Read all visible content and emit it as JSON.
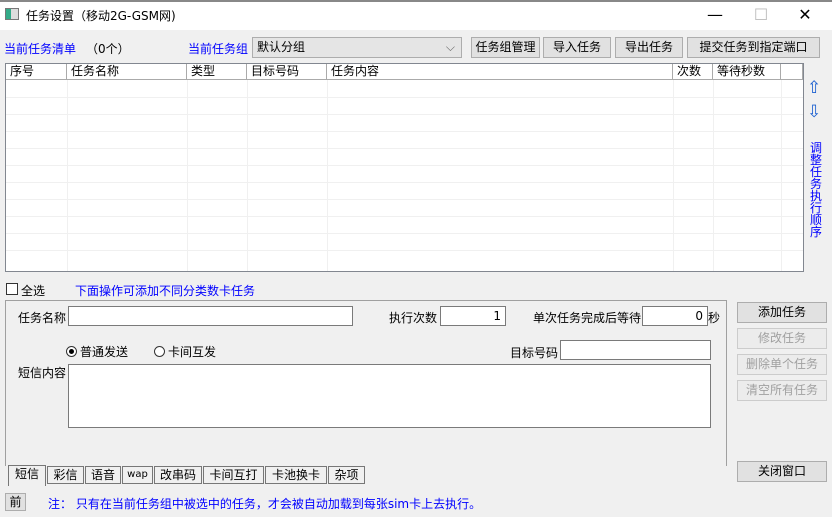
{
  "window": {
    "title": "任务设置（移动2G-GSM网)",
    "minimize": "—",
    "maximize": "☐",
    "close": "✕"
  },
  "toolbar": {
    "list_label": "当前任务清单",
    "count": "（0个）",
    "group_label": "当前任务组",
    "group_value": "默认分组",
    "group_manage": "任务组管理",
    "import": "导入任务",
    "export": "导出任务",
    "submit": "提交任务到指定端口"
  },
  "table": {
    "columns": [
      "序号",
      "任务名称",
      "类型",
      "目标号码",
      "任务内容",
      "次数",
      "等待秒数"
    ]
  },
  "side": {
    "order_label": "调整任务执行顺序"
  },
  "select_all": "全选",
  "hint": "下面操作可添加不同分类数卡任务",
  "form": {
    "name_label": "任务名称",
    "name_value": "",
    "exec_label": "执行次数",
    "exec_value": "1",
    "wait_label": "单次任务完成后等待",
    "wait_value": "0",
    "sec": "秒",
    "radio_normal": "普通发送",
    "radio_card": "卡间互发",
    "target_label": "目标号码",
    "target_value": "",
    "content_label": "短信内容",
    "content_value": ""
  },
  "tabs": [
    "短信",
    "彩信",
    "语音",
    "wap",
    "改串码",
    "卡间互打",
    "卡池换卡",
    "杂项"
  ],
  "buttons": {
    "add": "添加任务",
    "modify": "修改任务",
    "delete": "删除单个任务",
    "clear": "清空所有任务",
    "close": "关闭窗口"
  },
  "status": {
    "prev": "前",
    "note": "注：  只有在当前任务组中被选中的任务，才会被自动加载到每张sim卡上去执行。"
  }
}
